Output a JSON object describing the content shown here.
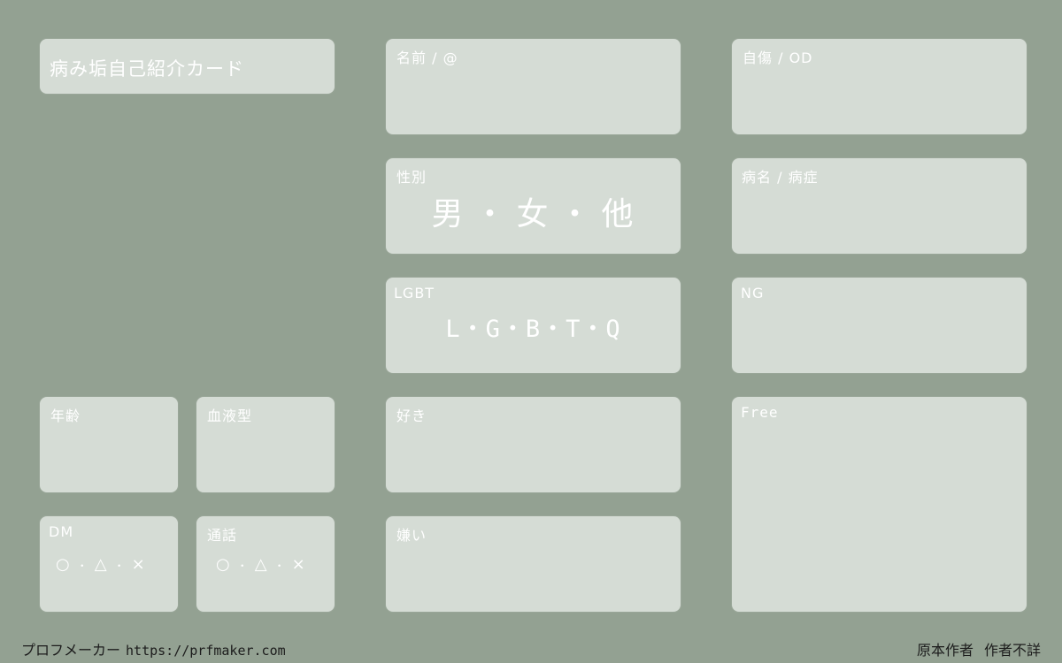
{
  "card": {
    "title": "病み垢自己紹介カード",
    "colors": {
      "background": "#93a192",
      "box": "#d5dcd5",
      "label": "#ffffff",
      "footer_text": "#1c1c1c"
    }
  },
  "fields": {
    "name": {
      "label": "名前 / @"
    },
    "selfharm": {
      "label": "自傷 / OD"
    },
    "gender": {
      "label": "性別",
      "options": [
        "男",
        "女",
        "他"
      ],
      "separator": "・"
    },
    "illness": {
      "label": "病名 / 病症"
    },
    "lgbt": {
      "label": "LGBT",
      "options": [
        "L",
        "G",
        "B",
        "T",
        "Q"
      ],
      "separator": "・"
    },
    "ng": {
      "label": "NG"
    },
    "age": {
      "label": "年齢"
    },
    "blood": {
      "label": "血液型"
    },
    "likes": {
      "label": "好き"
    },
    "free": {
      "label": "Free"
    },
    "dm": {
      "label": "DM",
      "options": [
        "○",
        "△",
        "×"
      ],
      "separator": "・"
    },
    "call": {
      "label": "通話",
      "options": [
        "○",
        "△",
        "×"
      ],
      "separator": "・"
    },
    "dislikes": {
      "label": "嫌い"
    }
  },
  "footer": {
    "site_name": "プロフメーカー",
    "url": "https://prfmaker.com",
    "author_label": "原本作者",
    "author_value": "作者不詳"
  }
}
